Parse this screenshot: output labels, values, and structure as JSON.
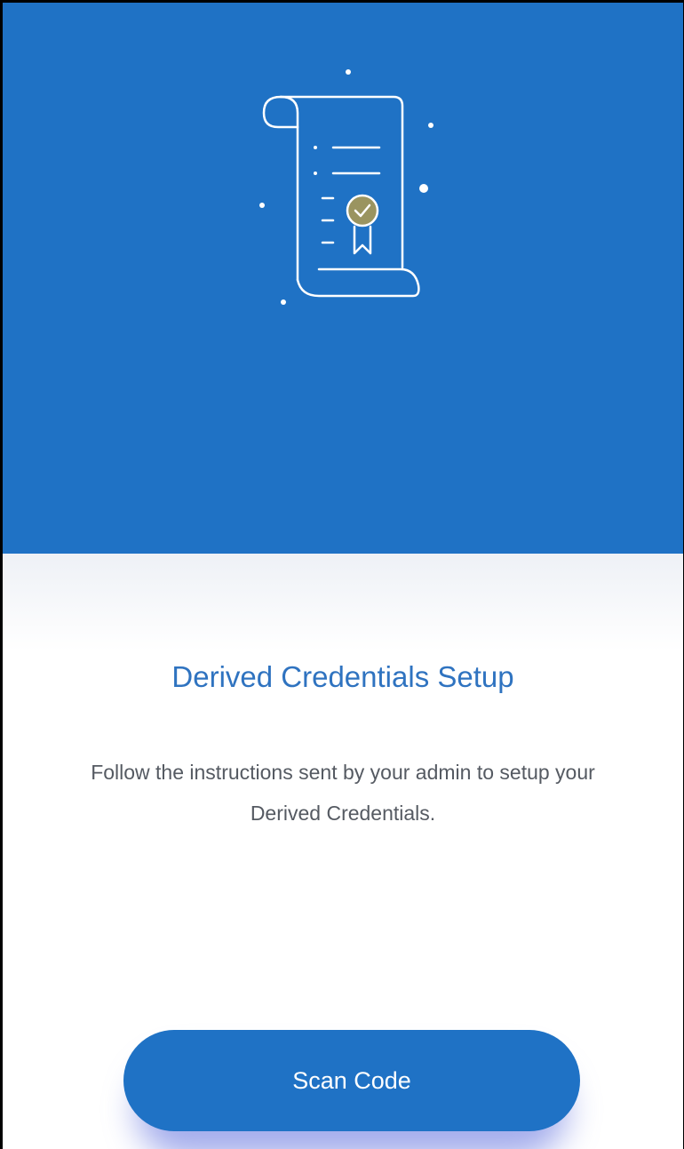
{
  "header": {
    "illustration_icon": "certificate-scroll-icon",
    "badge_icon": "award-ribbon-check-icon"
  },
  "main": {
    "title": "Derived Credentials Setup",
    "message": "Follow the instructions sent by your admin to setup your Derived Credentials."
  },
  "actions": {
    "scan_label": "Scan Code"
  },
  "colors": {
    "primary": "#1f72c5",
    "title": "#2f73c0",
    "body_text": "#555a62",
    "badge": "#9a9460"
  }
}
